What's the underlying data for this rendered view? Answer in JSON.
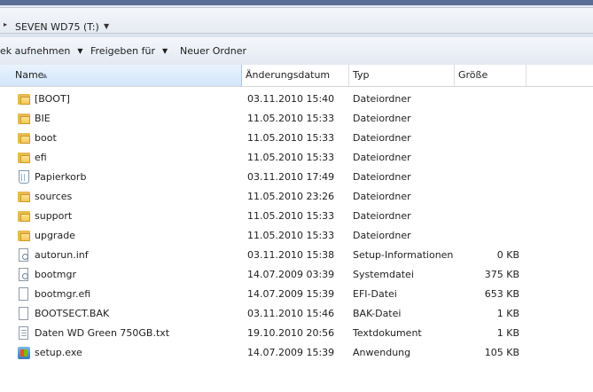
{
  "address": {
    "path_label": "SEVEN WD75 (T:)"
  },
  "toolbar": {
    "items": [
      {
        "label": "ek aufnehmen",
        "dropdown": true
      },
      {
        "label": "Freigeben für",
        "dropdown": true
      },
      {
        "label": "Neuer Ordner",
        "dropdown": false
      }
    ]
  },
  "columns": {
    "name": "Name",
    "date": "Änderungsdatum",
    "type": "Typ",
    "size": "Größe"
  },
  "files": [
    {
      "name": "[BOOT]",
      "date": "03.11.2010 15:40",
      "type": "Dateiordner",
      "size": "",
      "icon": "folder-icon"
    },
    {
      "name": "BIE",
      "date": "11.05.2010 15:33",
      "type": "Dateiordner",
      "size": "",
      "icon": "folder-icon"
    },
    {
      "name": "boot",
      "date": "11.05.2010 15:33",
      "type": "Dateiordner",
      "size": "",
      "icon": "folder-icon"
    },
    {
      "name": "efi",
      "date": "11.05.2010 15:33",
      "type": "Dateiordner",
      "size": "",
      "icon": "folder-icon"
    },
    {
      "name": "Papierkorb",
      "date": "03.11.2010 17:49",
      "type": "Dateiordner",
      "size": "",
      "icon": "recycle-bin-icon"
    },
    {
      "name": "sources",
      "date": "11.05.2010 23:26",
      "type": "Dateiordner",
      "size": "",
      "icon": "folder-icon"
    },
    {
      "name": "support",
      "date": "11.05.2010 15:33",
      "type": "Dateiordner",
      "size": "",
      "icon": "folder-icon"
    },
    {
      "name": "upgrade",
      "date": "11.05.2010 15:33",
      "type": "Dateiordner",
      "size": "",
      "icon": "folder-icon"
    },
    {
      "name": "autorun.inf",
      "date": "03.11.2010 15:38",
      "type": "Setup-Informationen",
      "size": "0 KB",
      "icon": "setup-info-icon"
    },
    {
      "name": "bootmgr",
      "date": "14.07.2009 03:39",
      "type": "Systemdatei",
      "size": "375 KB",
      "icon": "system-file-icon"
    },
    {
      "name": "bootmgr.efi",
      "date": "14.07.2009 15:39",
      "type": "EFI-Datei",
      "size": "653 KB",
      "icon": "file-icon"
    },
    {
      "name": "BOOTSECT.BAK",
      "date": "03.11.2010 15:46",
      "type": "BAK-Datei",
      "size": "1 KB",
      "icon": "file-icon"
    },
    {
      "name": "Daten WD Green 750GB.txt",
      "date": "19.10.2010 20:56",
      "type": "Textdokument",
      "size": "1 KB",
      "icon": "text-file-icon"
    },
    {
      "name": "setup.exe",
      "date": "14.07.2009 15:39",
      "type": "Anwendung",
      "size": "105 KB",
      "icon": "application-icon"
    }
  ]
}
